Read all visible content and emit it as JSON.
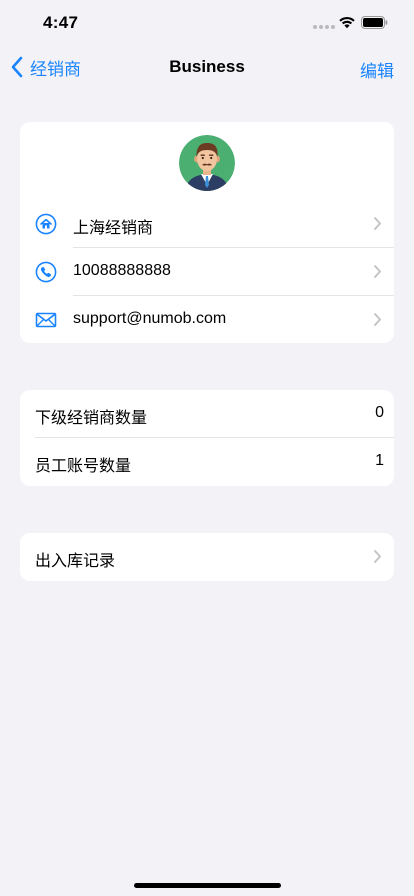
{
  "status_bar": {
    "time": "4:47"
  },
  "nav": {
    "back_label": "经销商",
    "title": "Business",
    "edit_label": "编辑"
  },
  "profile": {
    "name": "上海经销商",
    "phone": "10088888888",
    "email": "support@numob.com"
  },
  "stats": {
    "sub_dealers_label": "下级经销商数量",
    "sub_dealers_value": "0",
    "staff_accounts_label": "员工账号数量",
    "staff_accounts_value": "1"
  },
  "records": {
    "label": "出入库记录"
  },
  "colors": {
    "accent": "#1a84ff",
    "background": "#f2f2f7",
    "card": "#ffffff",
    "avatar_bg": "#4caf72"
  },
  "icons": {
    "name_row": "home-icon",
    "phone_row": "phone-icon",
    "email_row": "mail-icon",
    "disclosure": "chevron-right-icon"
  }
}
